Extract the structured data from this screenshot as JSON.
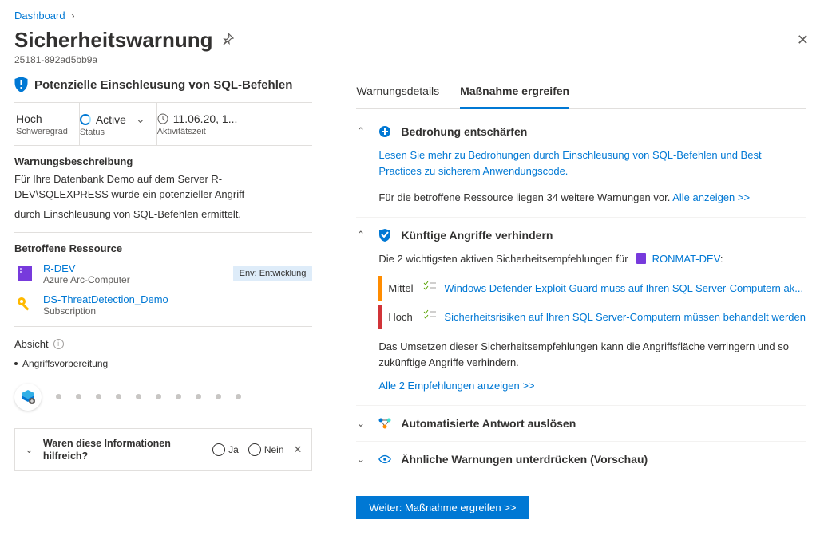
{
  "breadcrumb": {
    "home": "Dashboard"
  },
  "title": "Sicherheitswarnung",
  "sub_id": "25181-892ad5bb9a",
  "alert": {
    "title": "Potenzielle Einschleusung von SQL-Befehlen",
    "severity_val": "Hoch",
    "severity_label": "Schweregrad",
    "status_val": "Active",
    "status_label": "Status",
    "time_val": "11.06.20, 1...",
    "time_label": "Aktivitätszeit"
  },
  "description": {
    "heading": "Warnungsbeschreibung",
    "line1": "Für Ihre Datenbank Demo auf dem Server R-DEV\\SQLEXPRESS wurde ein potenzieller Angriff",
    "line2": "durch Einschleusung von SQL-Befehlen ermittelt."
  },
  "resource": {
    "heading": "Betroffene Ressource",
    "items": [
      {
        "name": "R-DEV",
        "type": "Azure Arc-Computer",
        "env": "Env: Entwicklung"
      },
      {
        "name": "DS-ThreatDetection_Demo",
        "type": "Subscription"
      }
    ]
  },
  "intent": {
    "heading": "Absicht",
    "stage": "Angriffsvorbereitung"
  },
  "feedback": {
    "question": "Waren diese Informationen hilfreich?",
    "yes": "Ja",
    "no": "Nein"
  },
  "tabs": {
    "details": "Warnungsdetails",
    "action": "Maßnahme ergreifen"
  },
  "sections": {
    "mitigate": {
      "title": "Bedrohung entschärfen",
      "link1": "Lesen Sie mehr zu Bedrohungen durch Einschleusung von SQL-Befehlen und Best Practices zu sicherem Anwendungscode.",
      "text2a": "Für die betroffene Ressource liegen 34 weitere Warnungen vor. ",
      "link2": "Alle anzeigen >>"
    },
    "prevent": {
      "title": "Künftige Angriffe verhindern",
      "intro": "Die 2 wichtigsten aktiven Sicherheitsempfehlungen für",
      "target": "RONMAT-DEV",
      "recs": [
        {
          "sev": "Mittel",
          "sev_class": "orange",
          "text": "Windows Defender Exploit Guard muss auf Ihren SQL Server-Computern ak..."
        },
        {
          "sev": "Hoch",
          "sev_class": "red",
          "text": "Sicherheitsrisiken auf Ihren SQL Server-Computern müssen behandelt werden"
        }
      ],
      "note": "Das Umsetzen dieser Sicherheitsempfehlungen kann die Angriffsfläche verringern und so zukünftige Angriffe verhindern.",
      "all_link": "Alle 2 Empfehlungen anzeigen >>"
    },
    "automate": {
      "title": "Automatisierte Antwort auslösen"
    },
    "suppress": {
      "title": "Ähnliche Warnungen unterdrücken (Vorschau)"
    }
  },
  "footer_button": "Weiter: Maßnahme ergreifen >>"
}
